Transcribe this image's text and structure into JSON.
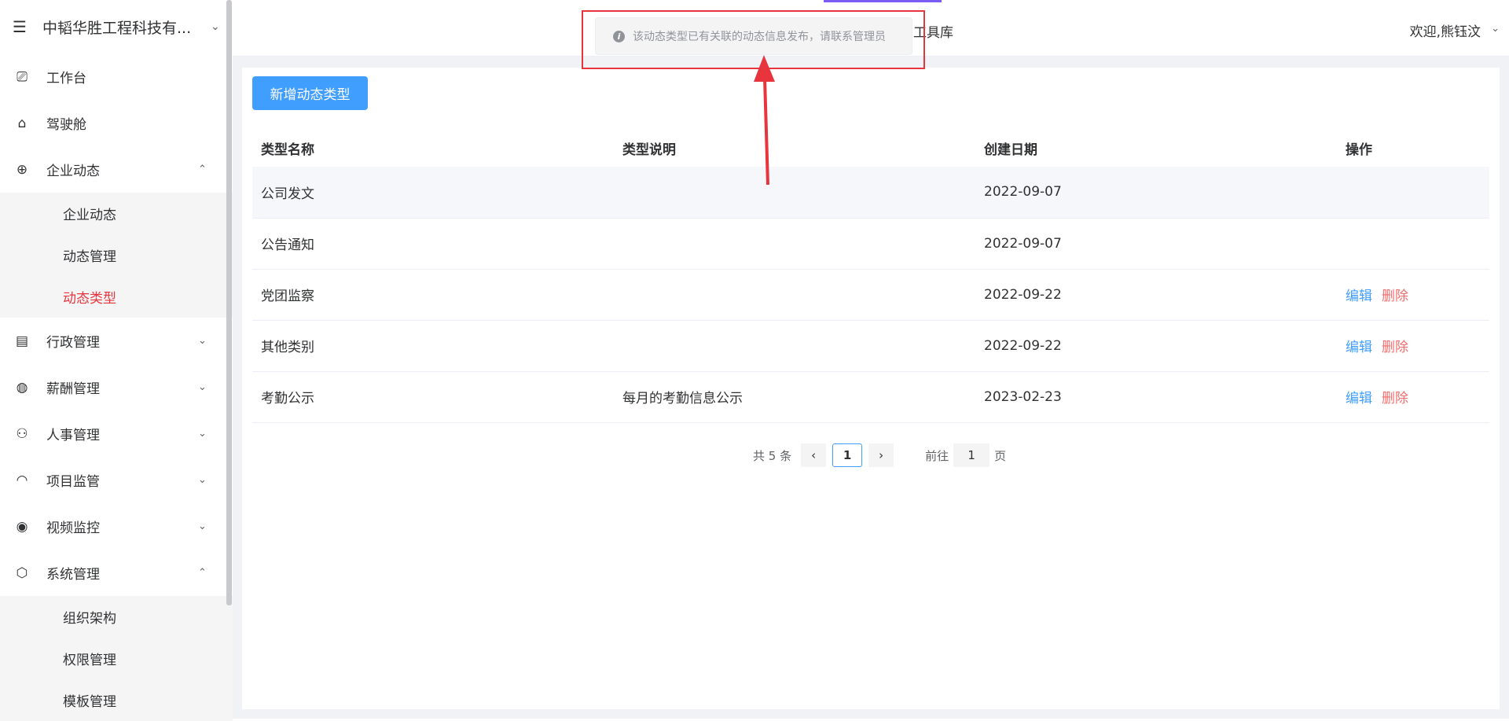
{
  "sidebar": {
    "org_name": "中韬华胜工程科技有...",
    "items": [
      {
        "label": "工作台",
        "icon": "monitor-icon",
        "glyph": "⎚"
      },
      {
        "label": "驾驶舱",
        "icon": "home-icon",
        "glyph": "⌂"
      },
      {
        "label": "企业动态",
        "icon": "globe-icon",
        "glyph": "⊕",
        "expanded": true
      }
    ],
    "sub_dynamics": [
      {
        "label": "企业动态"
      },
      {
        "label": "动态管理"
      },
      {
        "label": "动态类型",
        "active": true
      }
    ],
    "items2": [
      {
        "label": "行政管理",
        "icon": "building-icon",
        "glyph": "▤"
      },
      {
        "label": "薪酬管理",
        "icon": "salary-icon",
        "glyph": "◍"
      },
      {
        "label": "人事管理",
        "icon": "people-icon",
        "glyph": "⚇"
      },
      {
        "label": "项目监管",
        "icon": "helmet-icon",
        "glyph": "◠"
      },
      {
        "label": "视频监控",
        "icon": "camera-icon",
        "glyph": "◉"
      },
      {
        "label": "系统管理",
        "icon": "settings-icon",
        "glyph": "⬡",
        "expanded": true
      }
    ],
    "sub_system": [
      {
        "label": "组织架构"
      },
      {
        "label": "权限管理"
      },
      {
        "label": "模板管理"
      }
    ]
  },
  "header": {
    "tool_lib": "工具库",
    "welcome": "欢迎,熊钰汶"
  },
  "toast": {
    "message": "该动态类型已有关联的动态信息发布，请联系管理员"
  },
  "main": {
    "add_button": "新增动态类型",
    "columns": [
      "类型名称",
      "类型说明",
      "创建日期",
      "操作"
    ],
    "rows": [
      {
        "name": "公司发文",
        "desc": "",
        "date": "2022-09-07",
        "actions": false
      },
      {
        "name": "公告通知",
        "desc": "",
        "date": "2022-09-07",
        "actions": false
      },
      {
        "name": "党团监察",
        "desc": "",
        "date": "2022-09-22",
        "actions": true
      },
      {
        "name": "其他类别",
        "desc": "",
        "date": "2022-09-22",
        "actions": true
      },
      {
        "name": "考勤公示",
        "desc": "每月的考勤信息公示",
        "date": "2023-02-23",
        "actions": true
      }
    ],
    "edit_label": "编辑",
    "delete_label": "删除"
  },
  "pagination": {
    "total": "共 5 条",
    "current": "1",
    "goto_label": "前往",
    "goto_value": "1",
    "page_suffix": "页"
  },
  "colors": {
    "primary": "#409eff",
    "danger": "#f56c6c",
    "active_menu": "#e8343d",
    "annotation": "#e8343d"
  }
}
